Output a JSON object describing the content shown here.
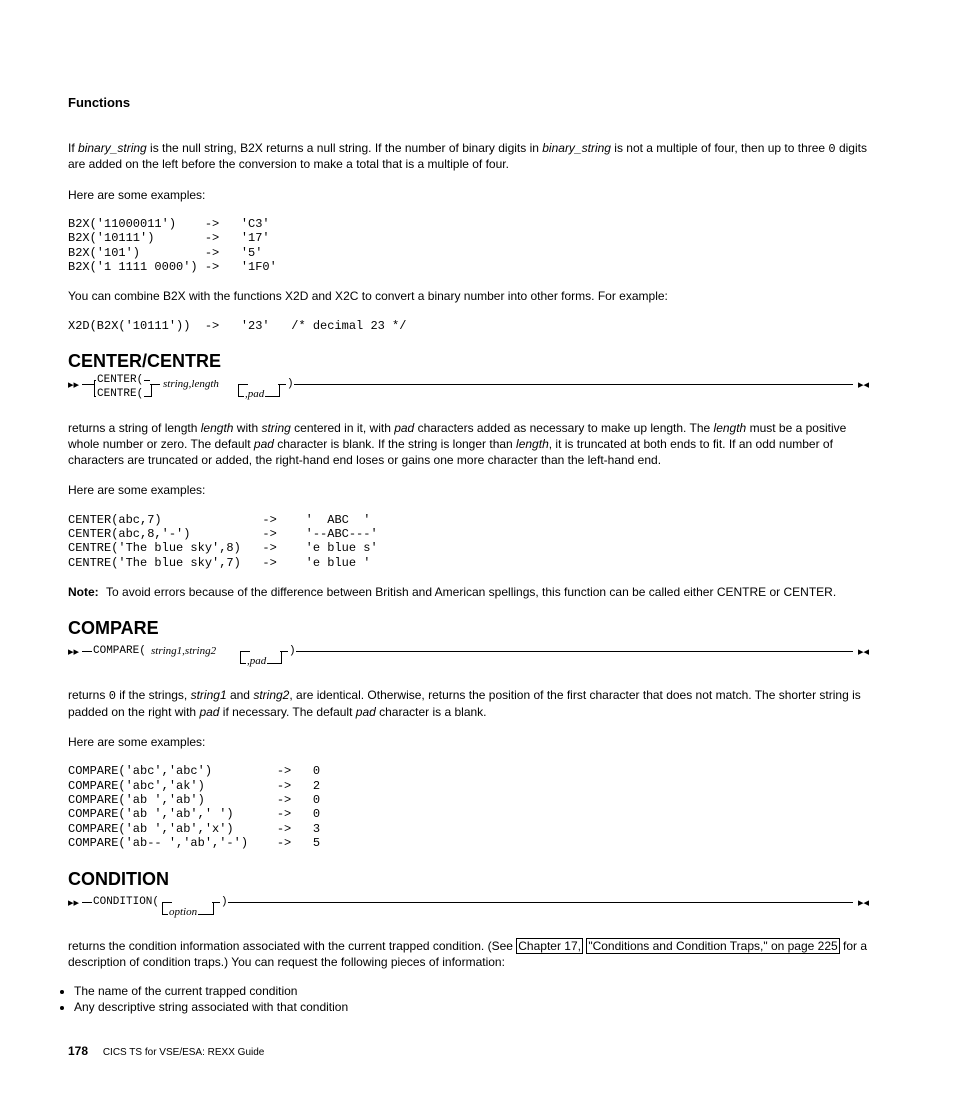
{
  "header": "Functions",
  "b2x": {
    "para_pre": "If ",
    "bs1": "binary_string",
    "para_mid1": " is the null string, B2X returns a null string. If the number of binary digits in ",
    "bs2": "binary_string",
    "para_mid2": " is not a multiple of four, then up to three ",
    "zero": "0",
    "para_end": " digits are added on the left before the conversion to make a total that is a multiple of four.",
    "examples_label": "Here are some examples:",
    "code": "B2X('11000011')    ->   'C3'\nB2X('10111')       ->   '17'\nB2X('101')         ->   '5'\nB2X('1 1111 0000') ->   '1F0'",
    "combine": "You can combine B2X with the functions X2D and X2C to convert a binary number into other forms. For example:",
    "code2": "X2D(B2X('10111'))  ->   '23'   /* decimal 23 */"
  },
  "center": {
    "title": "CENTER/CENTRE",
    "syntax": {
      "start": "──",
      "alt1": "CENTER(",
      "alt2": "CENTRE(",
      "args": "string,length",
      "pad": ",pad",
      "close": ")"
    },
    "para": {
      "p1": "returns a string of length ",
      "length1": "length",
      "p2": " with ",
      "string": "string",
      "p3": " centered in it, with ",
      "pad1": "pad",
      "p4": " characters added as necessary to make up length. The ",
      "length2": "length",
      "p5": " must be a positive whole number or zero. The default ",
      "pad2": "pad",
      "p6": " character is blank. If the string is longer than ",
      "length3": "length",
      "p7": ", it is truncated at both ends to fit. If an odd number of characters are truncated or added, the right-hand end loses or gains one more character than the left-hand end."
    },
    "examples_label": "Here are some examples:",
    "code": "CENTER(abc,7)              ->    '  ABC  '\nCENTER(abc,8,'-')          ->    '--ABC---'\nCENTRE('The blue sky',8)   ->    'e blue s'\nCENTRE('The blue sky',7)   ->    'e blue '",
    "note_label": "Note:",
    "note": "To avoid errors because of the difference between British and American spellings, this function can be called either CENTRE or CENTER."
  },
  "compare": {
    "title": "COMPARE",
    "syntax": {
      "fn": "COMPARE(",
      "args": "string1,string2",
      "pad": ",pad",
      "close": ")"
    },
    "para": {
      "p1": "returns ",
      "zero": "0",
      "p2": " if the strings, ",
      "s1": "string1",
      "p3": " and ",
      "s2": "string2",
      "p4": ", are identical. Otherwise, returns the position of the first character that does not match. The shorter string is padded on the right with ",
      "pad": "pad",
      "p5": " if necessary. The default ",
      "pad2": "pad",
      "p6": " character is a blank."
    },
    "examples_label": "Here are some examples:",
    "code": "COMPARE('abc','abc')         ->   0\nCOMPARE('abc','ak')          ->   2\nCOMPARE('ab ','ab')          ->   0\nCOMPARE('ab ','ab',' ')      ->   0\nCOMPARE('ab ','ab','x')      ->   3\nCOMPARE('ab-- ','ab','-')    ->   5"
  },
  "condition": {
    "title": "CONDITION",
    "syntax": {
      "fn": "CONDITION(",
      "opt": "option",
      "close": ")"
    },
    "para": {
      "p1": "returns the condition information associated with the current trapped condition. (See ",
      "link1": "Chapter 17,",
      "link2": "\"Conditions and Condition Traps,\" on page 225",
      "p2": " for a description of condition traps.) You can request the following pieces of information:"
    },
    "bullets": [
      "The name of the current trapped condition",
      "Any descriptive string associated with that condition"
    ]
  },
  "footer": {
    "page": "178",
    "text": "CICS TS for VSE/ESA: REXX Guide"
  }
}
